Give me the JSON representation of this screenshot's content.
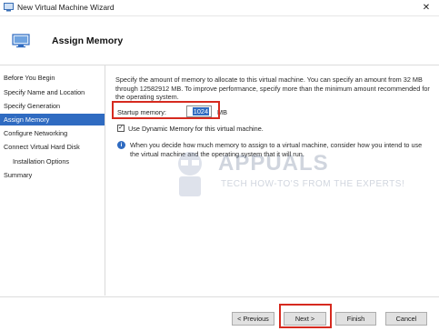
{
  "window": {
    "title": "New Virtual Machine Wizard",
    "close_glyph": "✕"
  },
  "header": {
    "title": "Assign Memory",
    "icon": "computer-monitor-icon"
  },
  "sidebar": {
    "items": [
      {
        "label": "Before You Begin"
      },
      {
        "label": "Specify Name and Location"
      },
      {
        "label": "Specify Generation"
      },
      {
        "label": "Assign Memory"
      },
      {
        "label": "Configure Networking"
      },
      {
        "label": "Connect Virtual Hard Disk"
      },
      {
        "label": "Installation Options"
      },
      {
        "label": "Summary"
      }
    ],
    "active_index": 3
  },
  "content": {
    "description": "Specify the amount of memory to allocate to this virtual machine. You can specify an amount from 32 MB through 12582912 MB. To improve performance, specify more than the minimum amount recommended for the operating system.",
    "startup_memory_label": "Startup memory:",
    "startup_memory_value": "1024",
    "startup_memory_unit": "MB",
    "dynamic_memory_label": "Use Dynamic Memory for this virtual machine.",
    "dynamic_memory_checked": true,
    "info_text": "When you decide how much memory to assign to a virtual machine, consider how you intend to use the virtual machine and the operating system that it will run."
  },
  "watermark": {
    "brand": "APPUALS",
    "tagline": "TECH HOW-TO'S FROM THE EXPERTS!"
  },
  "buttons": {
    "previous": "< Previous",
    "next": "Next >",
    "finish": "Finish",
    "cancel": "Cancel"
  },
  "colors": {
    "accent": "#2f6bc1",
    "highlight_box": "#d62a1f"
  }
}
